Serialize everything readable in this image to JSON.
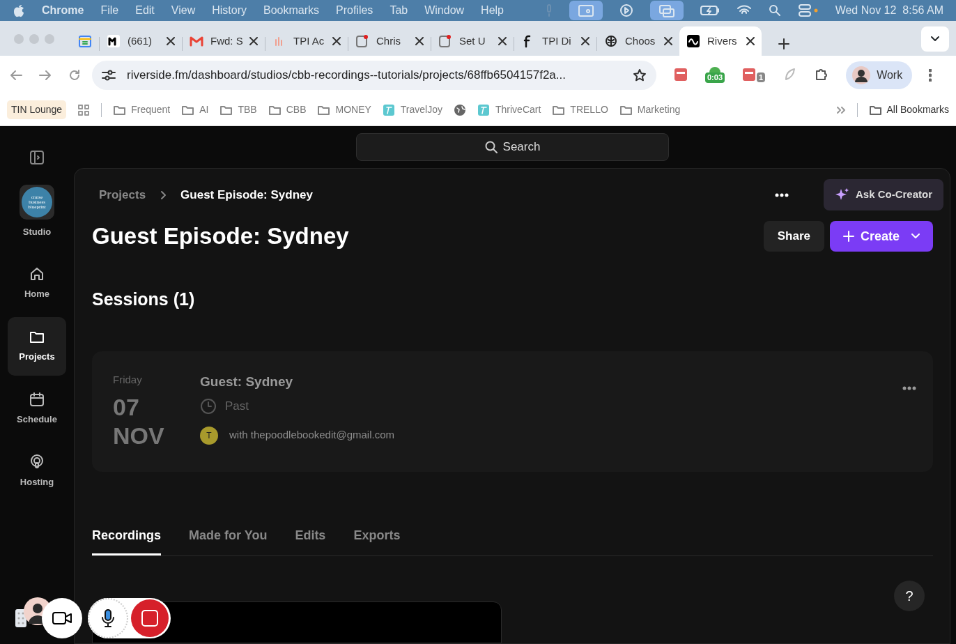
{
  "menu_bar": {
    "app": "Chrome",
    "menus": [
      "File",
      "Edit",
      "View",
      "History",
      "Bookmarks",
      "Profiles",
      "Tab",
      "Window",
      "Help"
    ],
    "clock": "Wed Nov 12  8:56 AM"
  },
  "browser_tabs": [
    {
      "kind": "calendar",
      "selected": false
    },
    {
      "kind": "mono",
      "title": "(661)",
      "selected": false
    },
    {
      "kind": "gmail",
      "title": "Fwd: S",
      "selected": false
    },
    {
      "kind": "bars",
      "title": "TPI Ac",
      "selected": false
    },
    {
      "kind": "app",
      "title": "Chris",
      "selected": false
    },
    {
      "kind": "app",
      "title": "Set U",
      "selected": false
    },
    {
      "kind": "facebook",
      "title": "TPI Di",
      "selected": false
    },
    {
      "kind": "knot",
      "title": "Choos",
      "selected": false
    },
    {
      "kind": "wave",
      "title": "Rivers",
      "selected": true
    }
  ],
  "address_bar": {
    "url": "riverside.fm/dashboard/studios/cbb-recordings--tutorials/projects/68ffb6504157f2a..."
  },
  "extensions": [
    {
      "kind": "tile"
    },
    {
      "kind": "timer",
      "badge": "0:03"
    },
    {
      "kind": "tile",
      "badge": "1"
    },
    {
      "kind": "leaf"
    },
    {
      "kind": "puzzle"
    }
  ],
  "profile": {
    "label": "Work"
  },
  "bookmarks": [
    {
      "kind": "chip",
      "label": "TIN Lounge"
    },
    {
      "kind": "grid"
    },
    {
      "kind": "folder",
      "label": "Frequent"
    },
    {
      "kind": "folder",
      "label": "AI"
    },
    {
      "kind": "folder",
      "label": "TBB"
    },
    {
      "kind": "folder",
      "label": "CBB"
    },
    {
      "kind": "folder",
      "label": "MONEY"
    },
    {
      "kind": "site",
      "label": "TravelJoy"
    },
    {
      "kind": "globe"
    },
    {
      "kind": "site",
      "label": "ThriveCart"
    },
    {
      "kind": "folder",
      "label": "TRELLO"
    },
    {
      "kind": "folder",
      "label": "Marketing"
    }
  ],
  "all_bookmarks": "All Bookmarks",
  "sidebar": {
    "logo_text": "cruise business blueprint",
    "studio_label": "Studio",
    "items": [
      {
        "kind": "home",
        "label": "Home",
        "selected": false
      },
      {
        "kind": "folder",
        "label": "Projects",
        "selected": true
      },
      {
        "kind": "calendar",
        "label": "Schedule",
        "selected": false
      },
      {
        "kind": "podcast",
        "label": "Hosting",
        "selected": false
      }
    ]
  },
  "search": {
    "placeholder": "Search"
  },
  "breadcrumb": [
    "Projects",
    "Guest Episode: Sydney"
  ],
  "co_creator_button": "Ask Co-Creator",
  "title": "Guest Episode: Sydney",
  "share_button": "Share",
  "create_button": "Create",
  "sessions": {
    "heading": "Sessions (1)",
    "items": [
      {
        "weekday": "Friday",
        "day": "07",
        "month": "NOV",
        "title": "Guest: Sydney",
        "status": "Past",
        "guest_initial": "T",
        "guest": "with thepoodlebookedit@gmail.com"
      }
    ]
  },
  "content_tabs": [
    {
      "label": "Recordings",
      "selected": true
    },
    {
      "label": "Made for You",
      "selected": false
    },
    {
      "label": "Edits",
      "selected": false
    },
    {
      "label": "Exports",
      "selected": false
    }
  ],
  "help_button": "?"
}
